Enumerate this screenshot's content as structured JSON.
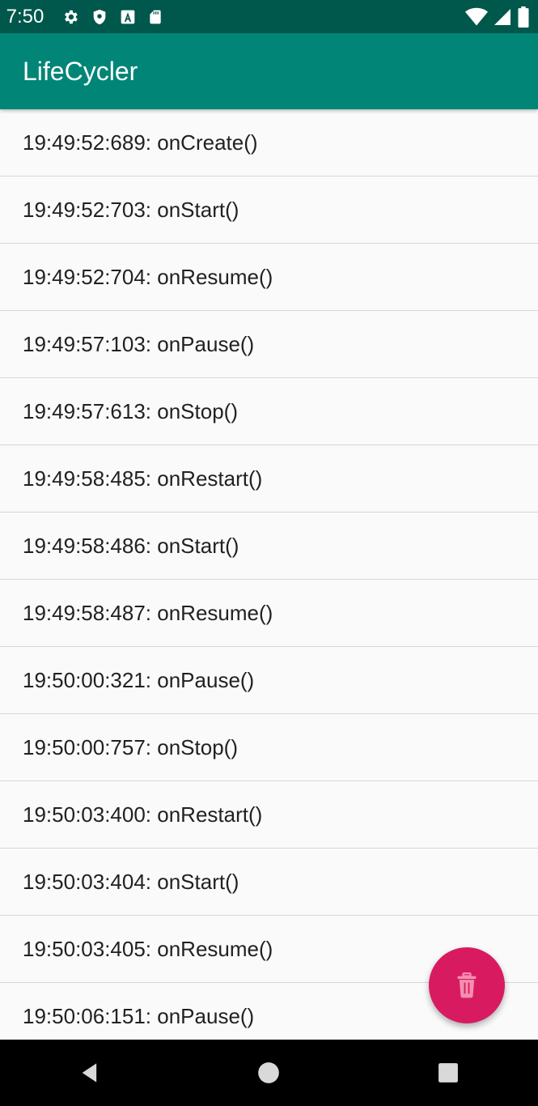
{
  "status_bar": {
    "time": "7:50",
    "left_icons": [
      "gear-icon",
      "shield-icon",
      "a-square-icon",
      "sd-card-icon"
    ],
    "right_icons": [
      "wifi-icon",
      "signal-icon",
      "battery-icon"
    ]
  },
  "app_bar": {
    "title": "LifeCycler"
  },
  "log_entries": [
    {
      "text": "19:49:52:689: onCreate()"
    },
    {
      "text": "19:49:52:703: onStart()"
    },
    {
      "text": "19:49:52:704: onResume()"
    },
    {
      "text": "19:49:57:103: onPause()"
    },
    {
      "text": "19:49:57:613: onStop()"
    },
    {
      "text": "19:49:58:485: onRestart()"
    },
    {
      "text": "19:49:58:486: onStart()"
    },
    {
      "text": "19:49:58:487: onResume()"
    },
    {
      "text": "19:50:00:321: onPause()"
    },
    {
      "text": "19:50:00:757: onStop()"
    },
    {
      "text": "19:50:03:400: onRestart()"
    },
    {
      "text": "19:50:03:404: onStart()"
    },
    {
      "text": "19:50:03:405: onResume()"
    },
    {
      "text": "19:50:06:151: onPause()"
    }
  ],
  "fab": {
    "icon": "trash-icon",
    "color": "#d81b60"
  },
  "nav_bar": {
    "buttons": [
      "back-icon",
      "home-icon",
      "recents-icon"
    ]
  },
  "colors": {
    "primary": "#008577",
    "primary_dark": "#00574b",
    "accent": "#d81b60"
  }
}
